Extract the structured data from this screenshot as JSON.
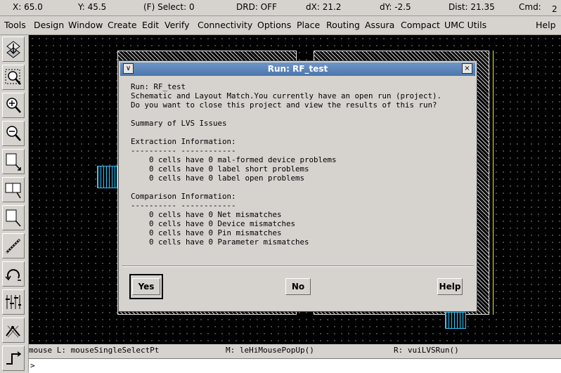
{
  "status": {
    "x": "X:  65.0",
    "y": "Y:  45.5",
    "select": "(F) Select: 0",
    "drd": "DRD: OFF",
    "dx": "dX:  21.2",
    "dy": "dY:  -2.5",
    "dist": "Dist: 21.35",
    "cmd": "Cmd:",
    "count": "2"
  },
  "menu": [
    "Tools",
    "Design",
    "Window",
    "Create",
    "Edit",
    "Verify",
    "Connectivity",
    "Options",
    "Place",
    "Routing",
    "Assura",
    "Compact",
    "UMC Utils",
    "Help"
  ],
  "toolbar_icons": [
    "save-view-icon",
    "zoom-fit-icon",
    "zoom-in-icon",
    "zoom-out-icon",
    "stretch-icon",
    "copy-icon",
    "move-icon",
    "ruler-icon",
    "undo-icon",
    "property-icon",
    "path-icon",
    "wire-icon"
  ],
  "dialog": {
    "title": "Run: RF_test",
    "message": "Run: RF_test\nSchematic and Layout Match.You currently have an open run (project).\nDo you want to close this project and view the results of this run?\n\nSummary of LVS Issues\n\nExtraction Information:\n---------- ------------\n    0 cells have 0 mal-formed device problems\n    0 cells have 0 label short problems\n    0 cells have 0 label open problems\n\nComparison Information:\n---------- ------------\n    0 cells have 0 Net mismatches\n    0 cells have 0 Device mismatches\n    0 cells have 0 Pin mismatches\n    0 cells have 0 Parameter mismatches",
    "yes": "Yes",
    "no": "No",
    "help": "Help",
    "menu_glyph": "∨",
    "close_glyph": "×"
  },
  "mouse": {
    "left": "mouse L: mouseSingleSelectPt",
    "middle": "M: leHiMousePopUp()",
    "right": "R: vuiLVSRun()"
  },
  "cmdline": {
    "prompt": ">"
  }
}
